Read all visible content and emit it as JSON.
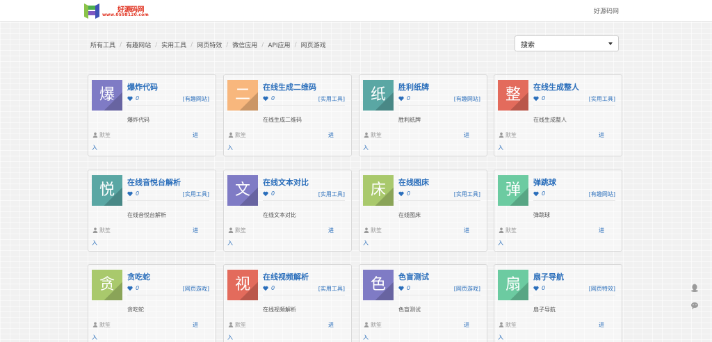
{
  "header": {
    "logo_text": "好源码网",
    "logo_url": "www.0598120.com",
    "site_link": "好源码网"
  },
  "breadcrumb": [
    "所有工具",
    "有趣网站",
    "实用工具",
    "网页特效",
    "微信应用",
    "API应用",
    "网页游戏"
  ],
  "search": {
    "selected": "搜索"
  },
  "cards": [
    {
      "glyph": "爆",
      "color": "#7f7bc5",
      "title": "爆炸代码",
      "likes": "0",
      "tag": "[有趣网站]",
      "desc": "爆炸代码",
      "author": "默笙",
      "enter_a": "进",
      "enter_b": "入"
    },
    {
      "glyph": "二",
      "color": "#f8b77d",
      "title": "在线生成二维码",
      "likes": "0",
      "tag": "[实用工具]",
      "desc": "在线生成二维码",
      "author": "默笙",
      "enter_a": "进",
      "enter_b": "入"
    },
    {
      "glyph": "纸",
      "color": "#5aa7a4",
      "title": "胜利纸牌",
      "likes": "0",
      "tag": "[有趣网站]",
      "desc": "胜利纸牌",
      "author": "默笙",
      "enter_a": "进",
      "enter_b": "入"
    },
    {
      "glyph": "整",
      "color": "#e36b5c",
      "title": "在线生成整人",
      "likes": "0",
      "tag": "[实用工具]",
      "desc": "在线生成整人",
      "author": "默笙",
      "enter_a": "进",
      "enter_b": "入"
    },
    {
      "glyph": "悦",
      "color": "#5aa7a4",
      "title": "在线音悦台解析",
      "likes": "0",
      "tag": "[实用工具]",
      "desc": "在线音悦台解析",
      "author": "默笙",
      "enter_a": "进",
      "enter_b": "入"
    },
    {
      "glyph": "文",
      "color": "#7f7bc5",
      "title": "在线文本对比",
      "likes": "0",
      "tag": "[实用工具]",
      "desc": "在线文本对比",
      "author": "默笙",
      "enter_a": "进",
      "enter_b": "入"
    },
    {
      "glyph": "床",
      "color": "#a9c96c",
      "title": "在线图床",
      "likes": "0",
      "tag": "[实用工具]",
      "desc": "在线图床",
      "author": "默笙",
      "enter_a": "进",
      "enter_b": "入"
    },
    {
      "glyph": "弹",
      "color": "#6ccba1",
      "title": "弹跳球",
      "likes": "0",
      "tag": "[有趣网站]",
      "desc": "弹跳球",
      "author": "默笙",
      "enter_a": "进",
      "enter_b": "入"
    },
    {
      "glyph": "贪",
      "color": "#a9c96c",
      "title": "贪吃蛇",
      "likes": "0",
      "tag": "[网页游戏]",
      "desc": "贪吃蛇",
      "author": "默笙",
      "enter_a": "进",
      "enter_b": "入"
    },
    {
      "glyph": "视",
      "color": "#e36b5c",
      "title": "在线视频解析",
      "likes": "0",
      "tag": "[实用工具]",
      "desc": "在线视频解析",
      "author": "默笙",
      "enter_a": "进",
      "enter_b": "入"
    },
    {
      "glyph": "色",
      "color": "#7f7bc5",
      "title": "色盲测试",
      "likes": "0",
      "tag": "[网页游戏]",
      "desc": "色盲测试",
      "author": "默笙",
      "enter_a": "进",
      "enter_b": "入"
    },
    {
      "glyph": "扇",
      "color": "#6ccba1",
      "title": "扇子导航",
      "likes": "0",
      "tag": "[网页特效]",
      "desc": "扇子导航",
      "author": "默笙",
      "enter_a": "进",
      "enter_b": "入"
    }
  ],
  "icons": {
    "heart": "heart-icon",
    "user": "user-icon",
    "side_a": "qq-icon",
    "side_b": "wechat-icon"
  }
}
